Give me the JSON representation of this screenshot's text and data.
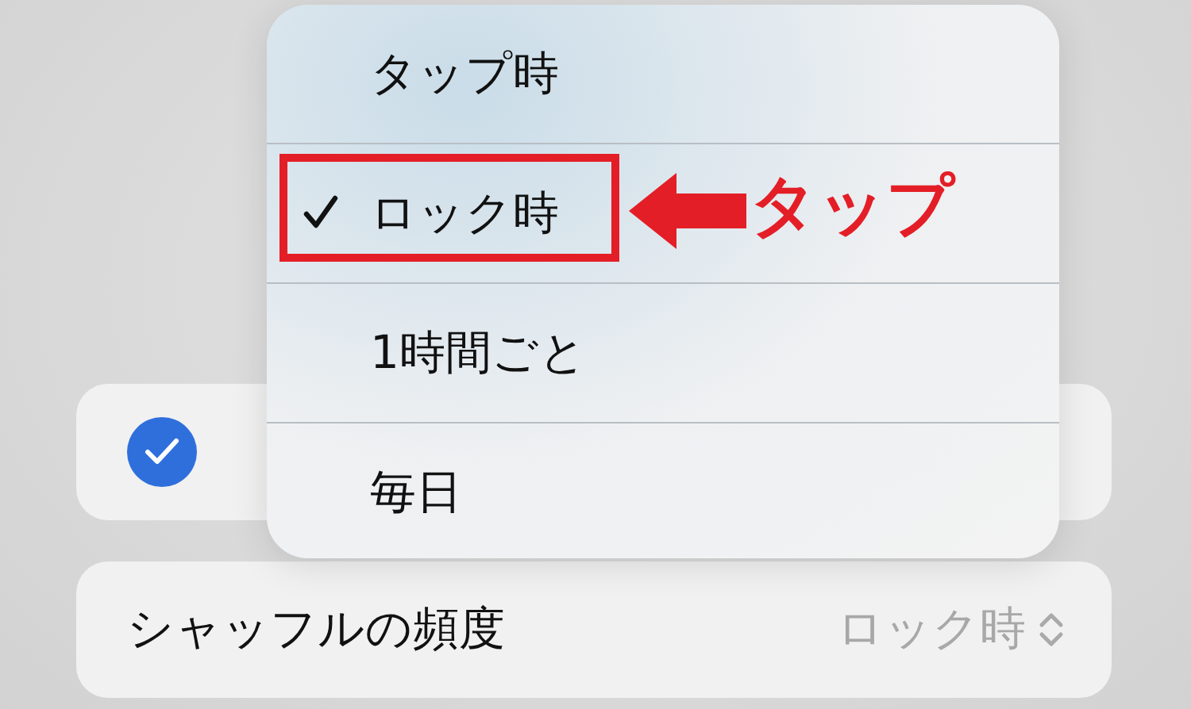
{
  "checkbox": {
    "checked": true
  },
  "setting": {
    "label": "シャッフルの頻度",
    "value": "ロック時"
  },
  "menu": {
    "options": [
      {
        "label": "タップ時",
        "selected": false
      },
      {
        "label": "ロック時",
        "selected": true
      },
      {
        "label": "1時間ごと",
        "selected": false
      },
      {
        "label": "毎日",
        "selected": false
      }
    ]
  },
  "annotation": {
    "label": "タップ"
  }
}
